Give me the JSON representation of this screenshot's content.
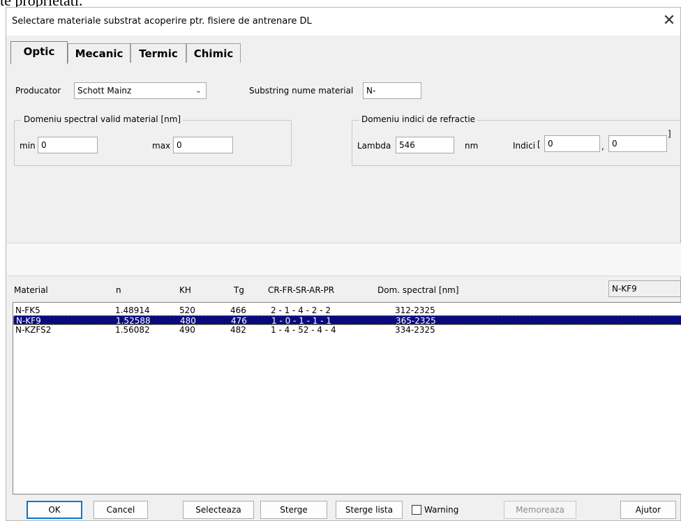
{
  "background_text": "te proprietati.",
  "window": {
    "title": "Selectare materiale substrat acoperire ptr. fisiere de antrenare DL",
    "close_glyph": "✕"
  },
  "tabs": [
    {
      "label": "Optic",
      "active": true
    },
    {
      "label": "Mecanic",
      "active": false
    },
    {
      "label": "Termic",
      "active": false
    },
    {
      "label": "Chimic",
      "active": false
    }
  ],
  "producer": {
    "label": "Producator",
    "value": "Schott Mainz"
  },
  "substring": {
    "label": "Substring nume material",
    "value": "N-"
  },
  "spectral_domain": {
    "label": "Domeniu spectral valid material [nm]",
    "min_label": "min",
    "min_value": "0",
    "max_label": "max",
    "max_value": "0"
  },
  "refraction_domain": {
    "label": "Domeniu indici de refractie",
    "lambda_label": "Lambda",
    "lambda_value": "546",
    "unit": "nm",
    "indices_label": "Indici",
    "open_bracket": "[",
    "index1": "0",
    "comma": ",",
    "index2": "0",
    "close_bracket": "]"
  },
  "list": {
    "headers": [
      "Material",
      "n",
      "KH",
      "Tg",
      "CR-FR-SR-AR-PR",
      "Dom. spectral [nm]"
    ],
    "search_value": "N-KF9",
    "rows": [
      {
        "material": "N-FK5",
        "n": "1.48914",
        "kh": "520",
        "tg": "466",
        "codes": "2 - 1 - 4 - 2 - 2",
        "spectral": "312-2325",
        "selected": false
      },
      {
        "material": "N-KF9",
        "n": "1.52588",
        "kh": "480",
        "tg": "476",
        "codes": "1 - 0 - 1 - 1 - 1",
        "spectral": "365-2325",
        "selected": true
      },
      {
        "material": "N-KZFS2",
        "n": "1.56082",
        "kh": "490",
        "tg": "482",
        "codes": "1 - 4 - 52 - 4 - 4",
        "spectral": "334-2325",
        "selected": false
      }
    ]
  },
  "buttons": {
    "ok": "OK",
    "cancel": "Cancel",
    "select": "Selecteaza",
    "delete": "Sterge",
    "delete_list": "Sterge lista",
    "warning": "Warning",
    "memorize": "Memoreaza",
    "help": "Ajutor"
  },
  "colors": {
    "selection": "#0a0a80",
    "default_button_border": "#0078d7"
  }
}
